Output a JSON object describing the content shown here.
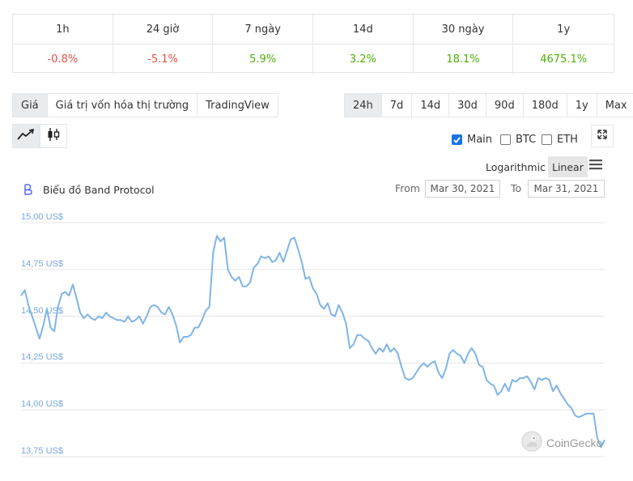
{
  "changes": {
    "headers": [
      "1h",
      "24 giờ",
      "7 ngày",
      "14d",
      "30 ngày",
      "1y"
    ],
    "values": [
      "-0.8%",
      "-5.1%",
      "5.9%",
      "3.2%",
      "18.1%",
      "4675.1%"
    ],
    "signs": [
      "neg",
      "neg",
      "pos",
      "pos",
      "pos",
      "pos"
    ]
  },
  "view_tabs": [
    "Giá",
    "Giá trị vốn hóa thị trường",
    "TradingView"
  ],
  "range_tabs": [
    "24h",
    "7d",
    "14d",
    "30d",
    "90d",
    "180d",
    "1y",
    "Max"
  ],
  "compare": {
    "main": "Main",
    "btc": "BTC",
    "eth": "ETH"
  },
  "scale": {
    "log": "Logarithmic",
    "linear": "Linear"
  },
  "chart_title": "Biểu đồ Band Protocol",
  "range": {
    "from_label": "From",
    "from": "Mar 30, 2021",
    "to_label": "To",
    "to": "Mar 31, 2021"
  },
  "watermark": "CoinGecko",
  "colors": {
    "line": "#7fb5e6",
    "negative": "#e15241",
    "positive": "#4eaf0a"
  },
  "icons": {
    "line_chart": "line-chart-icon",
    "candle": "candlestick-icon",
    "expand": "expand-icon",
    "menu": "hamburger-menu-icon",
    "logo": "band-logo-icon"
  },
  "chart_data": {
    "type": "line",
    "ylim": [
      13.75,
      15.0
    ],
    "yticks": [
      "15,00 US$",
      "14,75 US$",
      "14,50 US$",
      "14,25 US$",
      "14,00 US$",
      "13,75 US$"
    ],
    "ytick_values": [
      15.0,
      14.75,
      14.5,
      14.25,
      14.0,
      13.75
    ],
    "grid": true,
    "series": [
      {
        "values": [
          14.61,
          14.64,
          14.56,
          14.5,
          14.44,
          14.38,
          14.45,
          14.54,
          14.44,
          14.42,
          14.55,
          14.62,
          14.63,
          14.61,
          14.67,
          14.6,
          14.52,
          14.49,
          14.51,
          14.49,
          14.48,
          14.5,
          14.49,
          14.52,
          14.5,
          14.49,
          14.48,
          14.48,
          14.47,
          14.5,
          14.47,
          14.48,
          14.5,
          14.46,
          14.5,
          14.55,
          14.56,
          14.55,
          14.52,
          14.51,
          14.55,
          14.51,
          14.45,
          14.36,
          14.39,
          14.39,
          14.4,
          14.44,
          14.44,
          14.48,
          14.53,
          14.55,
          14.84,
          14.93,
          14.9,
          14.92,
          14.75,
          14.71,
          14.69,
          14.71,
          14.66,
          14.66,
          14.68,
          14.76,
          14.78,
          14.82,
          14.81,
          14.82,
          14.79,
          14.8,
          14.84,
          14.79,
          14.85,
          14.91,
          14.92,
          14.86,
          14.79,
          14.7,
          14.71,
          14.65,
          14.62,
          14.56,
          14.54,
          14.57,
          14.51,
          14.5,
          14.56,
          14.52,
          14.46,
          14.33,
          14.35,
          14.4,
          14.4,
          14.38,
          14.37,
          14.33,
          14.3,
          14.33,
          14.31,
          14.35,
          14.31,
          14.33,
          14.3,
          14.23,
          14.17,
          14.16,
          14.17,
          14.2,
          14.23,
          14.25,
          14.23,
          14.25,
          14.26,
          14.2,
          14.17,
          14.22,
          14.3,
          14.32,
          14.3,
          14.29,
          14.25,
          14.3,
          14.33,
          14.3,
          14.24,
          14.23,
          14.16,
          14.14,
          14.13,
          14.08,
          14.1,
          14.14,
          14.1,
          14.16,
          14.15,
          14.17,
          14.17,
          14.18,
          14.15,
          14.11,
          14.17,
          14.16,
          14.17,
          14.16,
          14.1,
          14.13,
          14.09,
          14.06,
          14.03,
          14.01,
          13.97,
          13.96,
          13.97,
          13.98,
          13.98,
          13.98,
          13.85,
          13.8,
          13.84
        ]
      }
    ]
  }
}
